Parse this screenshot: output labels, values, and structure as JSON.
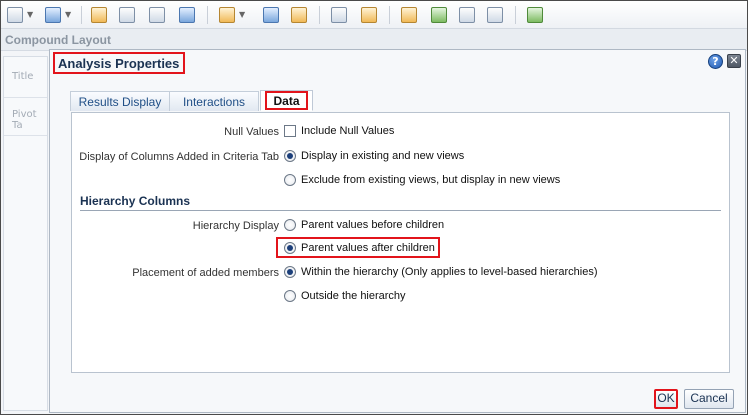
{
  "compound_layout": {
    "title": "Compound Layout",
    "side_items": [
      "Title",
      "Pivot Ta"
    ]
  },
  "dialog": {
    "title": "Analysis Properties",
    "help_glyph": "?",
    "close_glyph": "✕",
    "tabs": [
      {
        "label": "Results Display",
        "active": false
      },
      {
        "label": "Interactions",
        "active": false
      },
      {
        "label": "Data",
        "active": true
      }
    ],
    "null_values": {
      "label": "Null Values",
      "option": "Include Null Values",
      "checked": false
    },
    "display_columns": {
      "label": "Display of Columns Added in Criteria Tab",
      "options": [
        {
          "label": "Display in existing and new views",
          "selected": true
        },
        {
          "label": "Exclude from existing views, but display in new views",
          "selected": false
        }
      ]
    },
    "hierarchy_section": "Hierarchy Columns",
    "hierarchy_display": {
      "label": "Hierarchy Display",
      "options": [
        {
          "label": "Parent values before children",
          "selected": false
        },
        {
          "label": "Parent values after children",
          "selected": true
        }
      ]
    },
    "placement": {
      "label": "Placement of added members",
      "options": [
        {
          "label": "Within the hierarchy (Only applies to level-based hierarchies)",
          "selected": true
        },
        {
          "label": "Outside the hierarchy",
          "selected": false
        }
      ]
    },
    "buttons": {
      "ok": "OK",
      "cancel": "Cancel"
    }
  },
  "colors": {
    "highlight": "#e2141b",
    "title_text": "#1a3252",
    "tab_text": "#1f4e86"
  }
}
